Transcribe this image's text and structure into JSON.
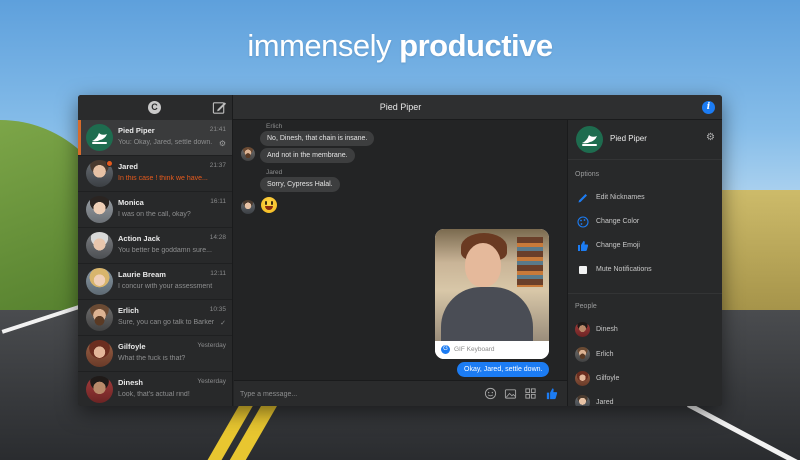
{
  "headline": {
    "light": "immensely",
    "bold": "productive"
  },
  "titlebar": {
    "title": "Pied Piper",
    "logo_letter": "C",
    "info_letter": "i"
  },
  "conversations": [
    {
      "name": "Pied Piper",
      "time": "21:41",
      "preview": "You: Okay, Jared, settle down.",
      "active": true
    },
    {
      "name": "Jared",
      "time": "21:37",
      "preview": "In this case ! think we have...",
      "unread": true
    },
    {
      "name": "Monica",
      "time": "16:11",
      "preview": "I was on the call, okay?"
    },
    {
      "name": "Action Jack",
      "time": "14:28",
      "preview": "You better be goddamn sure..."
    },
    {
      "name": "Laurie Bream",
      "time": "12:11",
      "preview": "I concur with your assessment"
    },
    {
      "name": "Erlich",
      "time": "10:35",
      "preview": "Sure, you can go talk to Barker"
    },
    {
      "name": "Gilfoyle",
      "time": "Yesterday",
      "preview": "What the fuck is that?"
    },
    {
      "name": "Dinesh",
      "time": "Yesterday",
      "preview": "Look, that's actual rind!"
    }
  ],
  "messages": {
    "erlich_sender": "Erlich",
    "erlich_1": "No, Dinesh, that chain is insane.",
    "erlich_2": "And not in the membrane.",
    "jared_sender": "Jared",
    "jared_1": "Sorry, Cypress Halal.",
    "gif_label": "GIF Keyboard",
    "gif_icon": "G",
    "outgoing": "Okay, Jared, settle down."
  },
  "composer": {
    "placeholder": "Type a message..."
  },
  "panel": {
    "name": "Pied Piper",
    "options_title": "Options",
    "options": [
      "Edit Nicknames",
      "Change Color",
      "Change Emoji",
      "Mute Notifications"
    ],
    "people_title": "People",
    "people": [
      "Dinesh",
      "Erlich",
      "Gilfoyle",
      "Jared"
    ]
  },
  "colors": {
    "accent": "#1c7cf3",
    "unread": "#e55a1d",
    "active_bar": "#d76b2b"
  }
}
